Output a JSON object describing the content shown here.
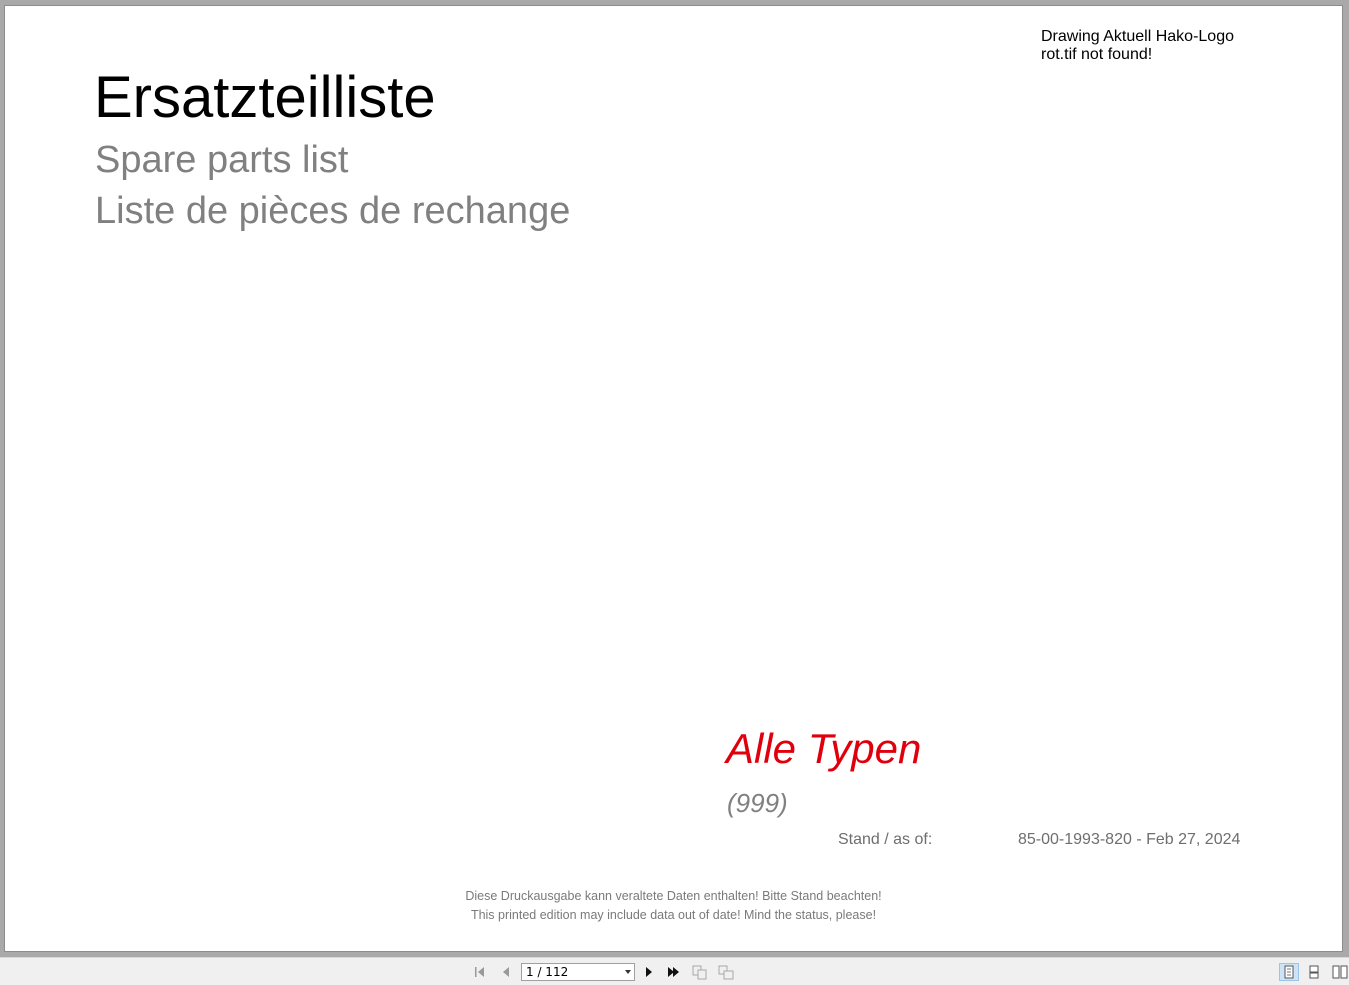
{
  "document": {
    "logo_missing_text": "Drawing Aktuell Hako-Logo rot.tif not found!",
    "title": "Ersatzteilliste",
    "subtitle_en": "Spare parts list",
    "subtitle_fr": "Liste de pièces de rechange",
    "type_name": "Alle Typen",
    "type_code": "(999)",
    "status_label": "Stand / as of:",
    "status_value": "85-00-1993-820 - Feb 27, 2024",
    "disclaimer_de": "Diese Druckausgabe kann veraltete Daten enthalten! Bitte Stand beachten!",
    "disclaimer_en": "This printed edition may include data out of date! Mind the status, please!"
  },
  "toolbar": {
    "page_indicator": "1 / 112",
    "icons": {
      "first": "first-page-icon",
      "prev": "previous-page-icon",
      "next": "next-page-icon",
      "last": "last-page-icon",
      "copy1": "copy-pages-icon",
      "copy2": "move-pages-icon",
      "view_single": "single-page-view-icon",
      "view_continuous": "continuous-view-icon",
      "view_facing": "facing-pages-view-icon"
    },
    "accent": "#cfe3f7"
  },
  "colors": {
    "title": "#000000",
    "subtitle": "#808080",
    "type_name": "#e0000d",
    "muted": "#6e6e6e"
  }
}
